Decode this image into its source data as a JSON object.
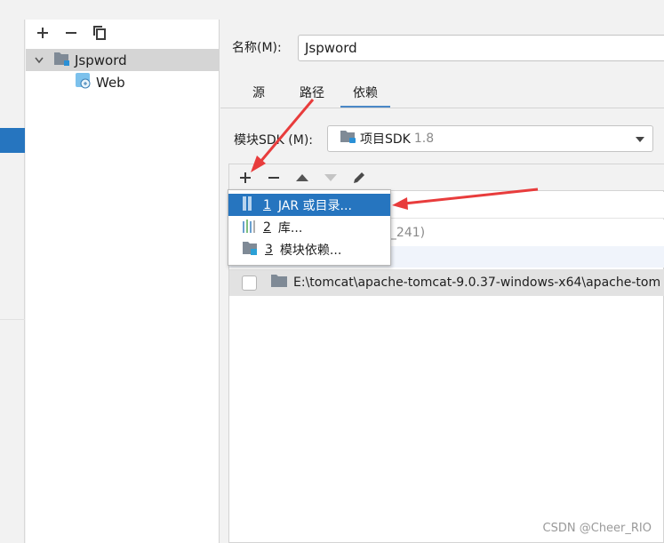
{
  "tree": {
    "toolbar": [
      "add",
      "remove",
      "copy"
    ],
    "module_name": "Jspword",
    "facet_name": "Web"
  },
  "form": {
    "name_label": "名称(M):",
    "name_value": "Jspword",
    "tabs": [
      "源",
      "路径",
      "依赖"
    ],
    "active_tab": "依赖",
    "sdk_label": "模块SDK (M):",
    "sdk_value": "项目SDK",
    "sdk_version": "1.8"
  },
  "deps": {
    "toolbar": [
      "add",
      "remove",
      "move-up",
      "move-down",
      "edit"
    ],
    "sdk_row_partial": "0_241)",
    "tomcat_path": "E:\\tomcat\\apache-tomcat-9.0.37-windows-x64\\apache-tom"
  },
  "menu": {
    "items": [
      {
        "num": "1",
        "label": "JAR 或目录..."
      },
      {
        "num": "2",
        "label": "库..."
      },
      {
        "num": "3",
        "label": "模块依赖..."
      }
    ]
  },
  "watermark": "CSDN @Cheer_RIO",
  "colors": {
    "accent": "#2675bf",
    "arrow": "#e83c3c",
    "folder": "#7f8a96"
  }
}
